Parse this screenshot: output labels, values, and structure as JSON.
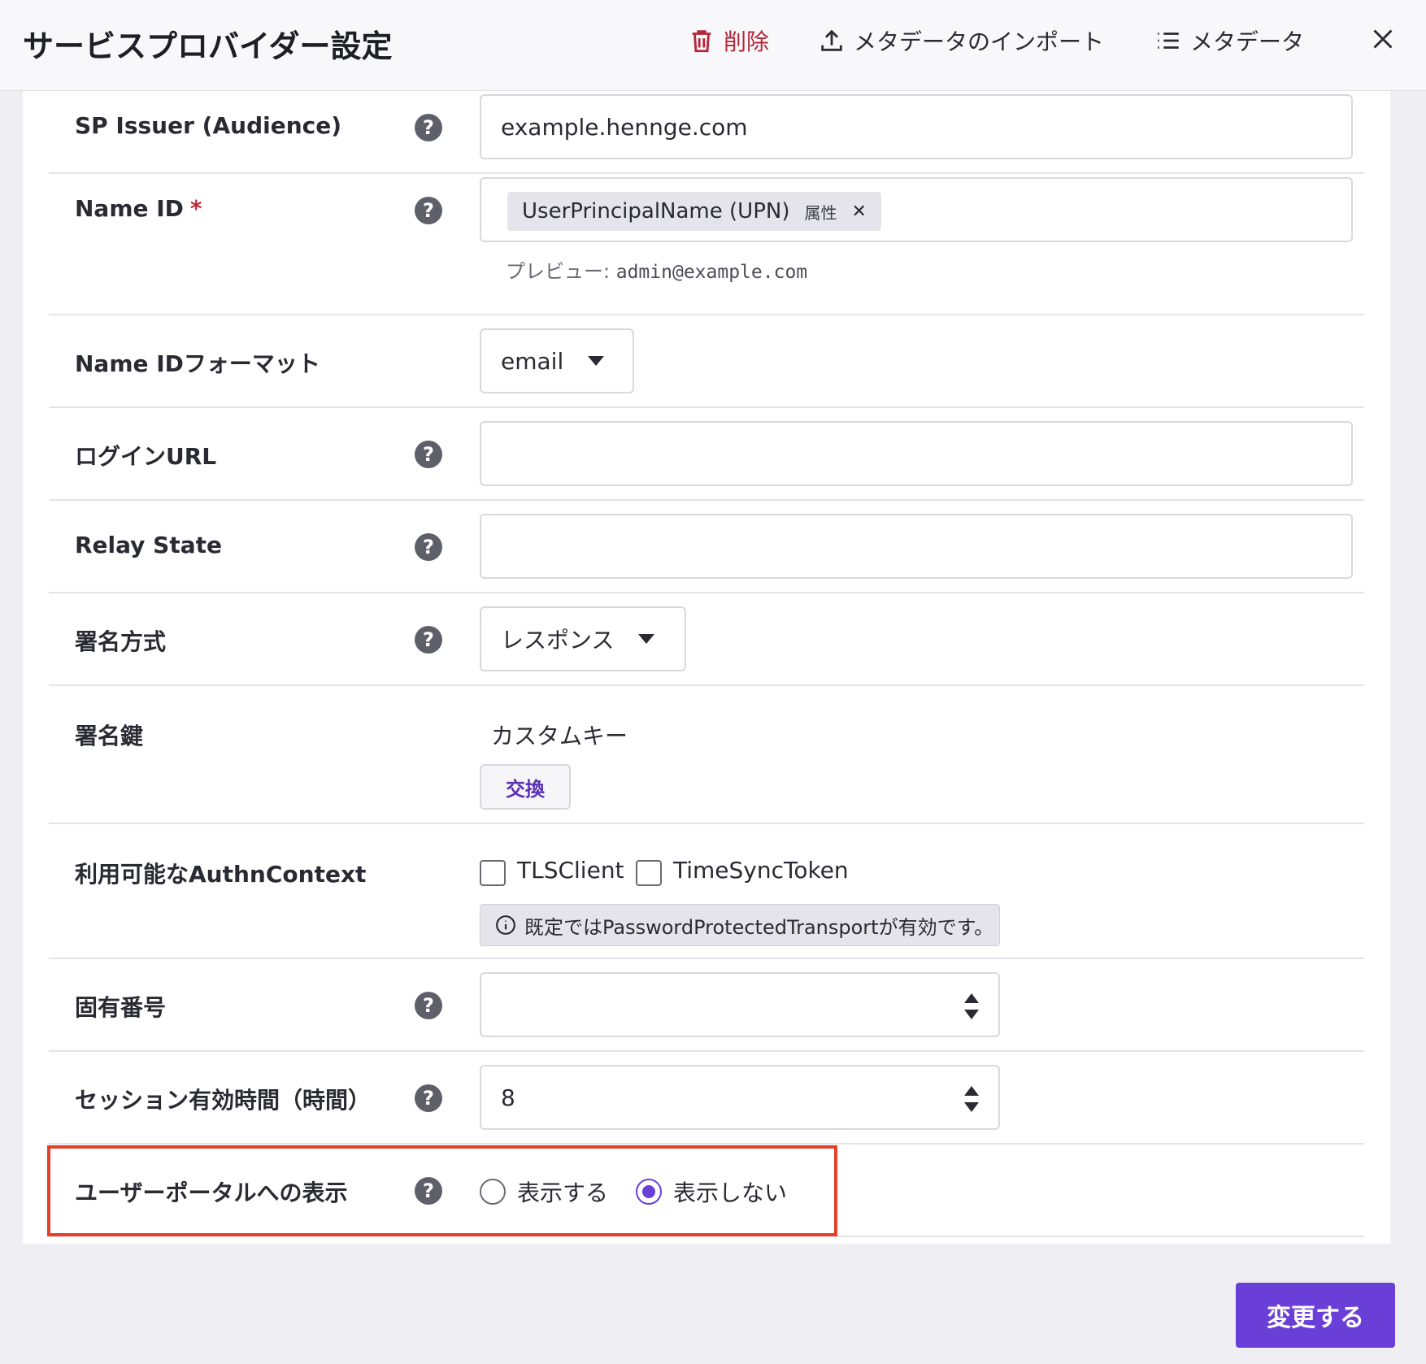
{
  "header": {
    "title": "サービスプロバイダー設定",
    "delete_label": "削除",
    "import_label": "メタデータのインポート",
    "metadata_label": "メタデータ"
  },
  "colors": {
    "accent": "#6a3fd8",
    "danger": "#b3263b",
    "highlight": "#e4412b"
  },
  "form": {
    "sp_issuer": {
      "label": "SP Issuer (Audience)",
      "value": "example.hennge.com"
    },
    "name_id": {
      "label": "Name ID",
      "required_mark": "*",
      "tag_value": "UserPrincipalName (UPN)",
      "tag_kind": "属性",
      "preview_label": "プレビュー:",
      "preview_value": "admin@example.com"
    },
    "name_id_format": {
      "label": "Name IDフォーマット",
      "value": "email"
    },
    "login_url": {
      "label": "ログインURL",
      "value": ""
    },
    "relay_state": {
      "label": "Relay State",
      "value": ""
    },
    "signing_method": {
      "label": "署名方式",
      "value": "レスポンス"
    },
    "signing_key": {
      "label": "署名鍵",
      "value": "カスタムキー",
      "swap_label": "交換"
    },
    "authn_context": {
      "label": "利用可能なAuthnContext",
      "options": [
        {
          "label": "TLSClient",
          "checked": false
        },
        {
          "label": "TimeSyncToken",
          "checked": false
        }
      ],
      "info": "既定ではPasswordProtectedTransportが有効です。"
    },
    "unique_number": {
      "label": "固有番号",
      "value": ""
    },
    "session_hours": {
      "label": "セッション有効時間（時間）",
      "value": "8"
    },
    "portal_display": {
      "label": "ユーザーポータルへの表示",
      "options": [
        {
          "label": "表示する",
          "selected": false
        },
        {
          "label": "表示しない",
          "selected": true
        }
      ]
    }
  },
  "footer": {
    "submit_label": "変更する"
  }
}
